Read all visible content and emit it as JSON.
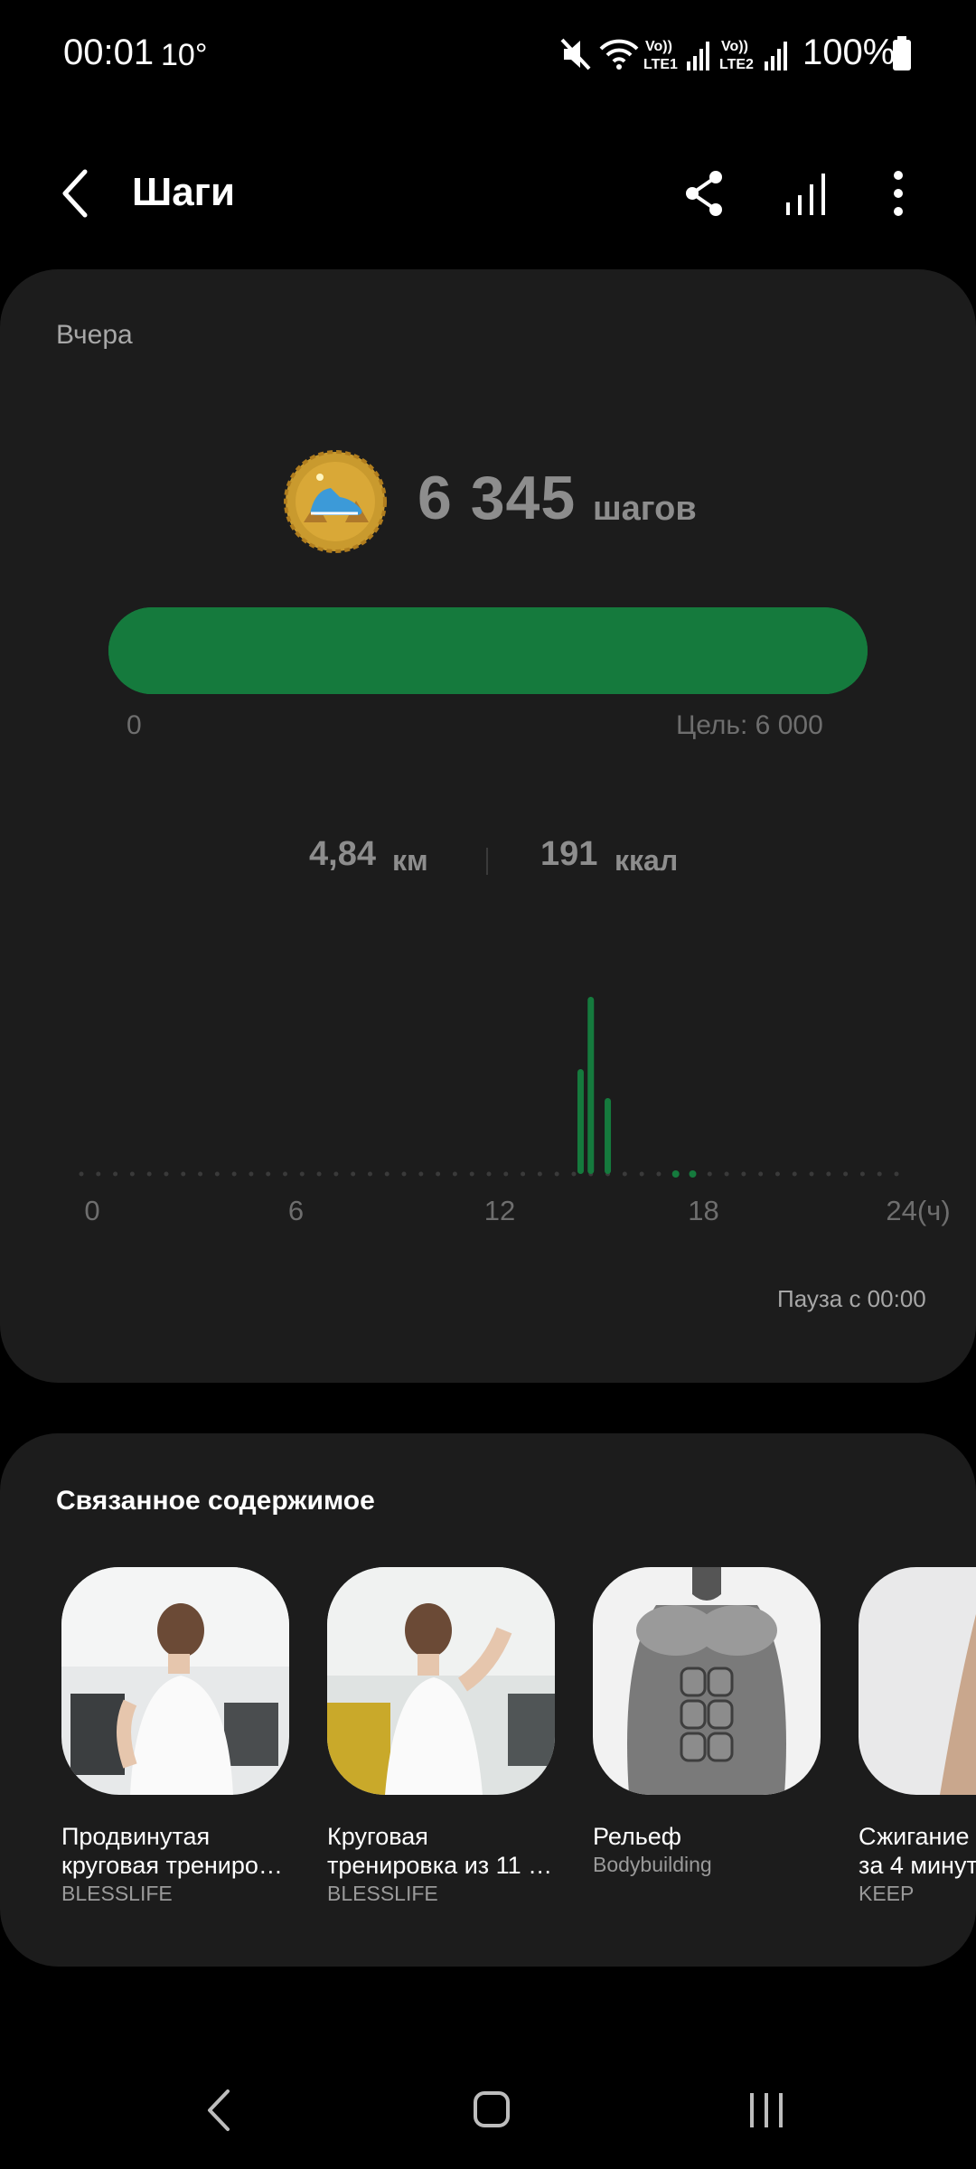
{
  "status_bar": {
    "time": "00:01",
    "temperature": "10°",
    "battery_percent": "100%",
    "icons": [
      "mute-icon",
      "wifi-icon",
      "volte-lte1-icon",
      "signal-icon",
      "volte-lte2-icon",
      "signal-icon",
      "battery-icon"
    ]
  },
  "app_bar": {
    "title": "Шаги",
    "icons": [
      "back-icon",
      "share-icon",
      "bar-chart-icon",
      "more-icon"
    ]
  },
  "summary": {
    "day_label": "Вчера",
    "steps_value": "6 345",
    "steps_unit": "шагов",
    "progress_min": "0",
    "goal_label": "Цель: 6 000",
    "progress_fraction": 1.0,
    "distance_value": "4,84",
    "distance_unit": "км",
    "calories_value": "191",
    "calories_unit": "ккал",
    "pause_label": "Пауза с 00:00"
  },
  "chart_data": {
    "type": "bar",
    "x_ticks": [
      "0",
      "6",
      "12",
      "18",
      "24(ч)"
    ],
    "xlim": [
      0,
      24
    ],
    "hours": [
      14.7,
      15.0,
      15.5
    ],
    "values": [
      0.58,
      0.98,
      0.42
    ],
    "active_dots": [
      17.5,
      18.0
    ],
    "accent_color": "#157a3d",
    "dot_color": "#3a3a3a"
  },
  "related": {
    "title": "Связанное содержимое",
    "items": [
      {
        "title_line1": "Продвинутая",
        "title_line2": "круговая трениро…",
        "source": "BLESSLIFE"
      },
      {
        "title_line1": "Круговая",
        "title_line2": "тренировка из 11 …",
        "source": "BLESSLIFE"
      },
      {
        "title_line1": "Рельеф",
        "title_line2": "",
        "source": "Bodybuilding"
      },
      {
        "title_line1": "Сжигание",
        "title_line2": "за 4 минут",
        "source": "KEEP"
      }
    ]
  },
  "nav_bar": {
    "icons": [
      "nav-back-icon",
      "nav-home-icon",
      "nav-recents-icon"
    ]
  }
}
